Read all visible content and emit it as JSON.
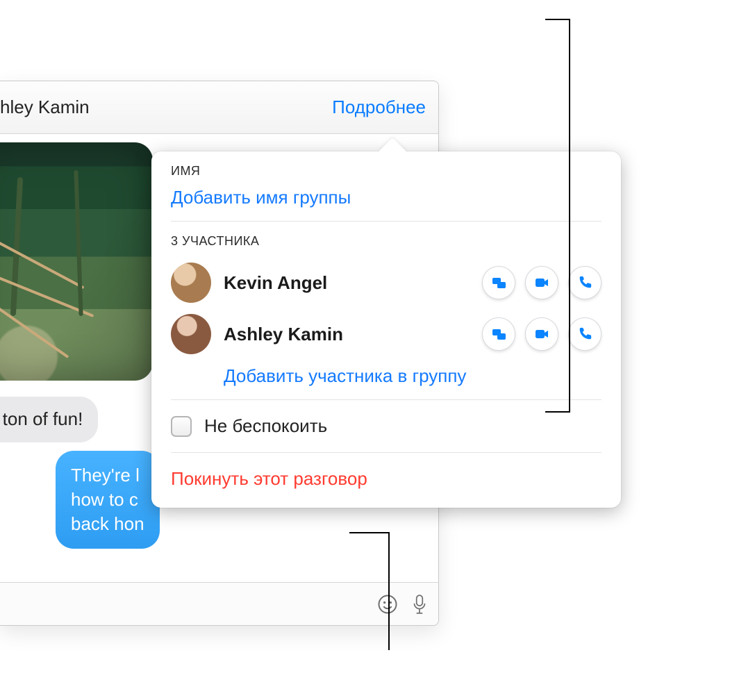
{
  "header": {
    "contact_fragment": "hley Kamin",
    "details_label": "Подробнее"
  },
  "messages": {
    "gray_bubble": "a ton of fun!",
    "blue_bubble": "They're l\nhow to c\nback hon"
  },
  "popover": {
    "name_label": "ИМЯ",
    "add_group_name": "Добавить имя группы",
    "participants_label": "3 УЧАСТНИКА",
    "participants": [
      {
        "name": "Kevin Angel"
      },
      {
        "name": "Ashley Kamin"
      }
    ],
    "add_member": "Добавить участника в группу",
    "dnd_label": "Не беспокоить",
    "leave_label": "Покинуть этот разговор"
  }
}
